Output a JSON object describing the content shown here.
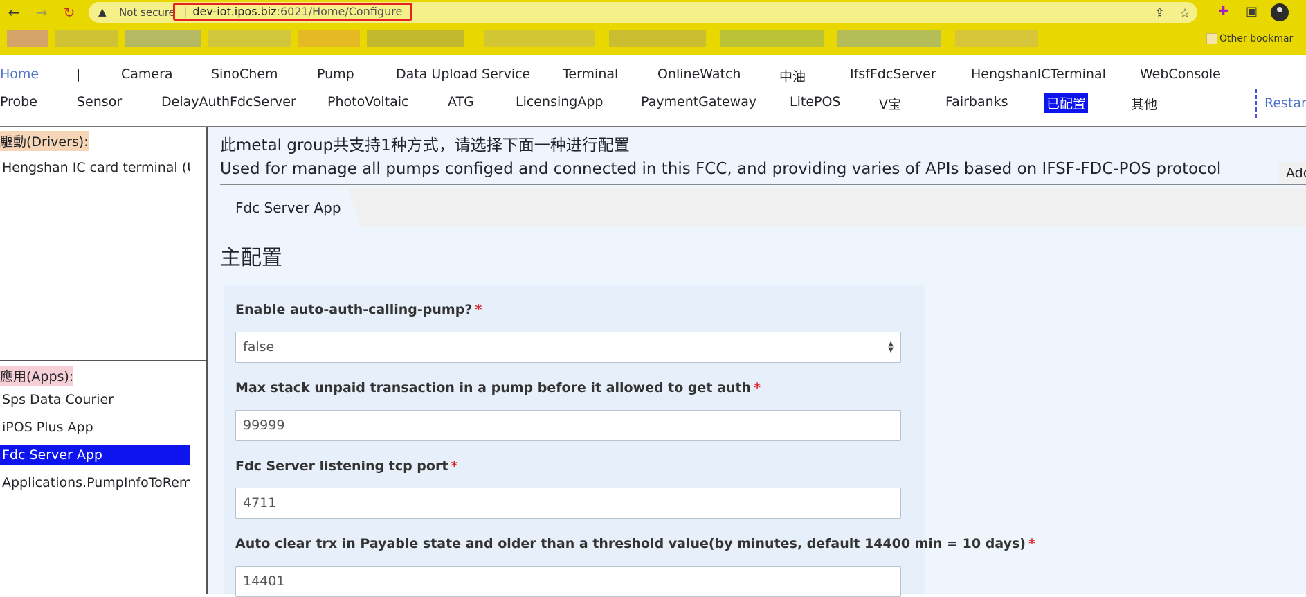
{
  "browser": {
    "security_label": "Not secure",
    "url_host": "dev-iot.ipos.biz",
    "url_path": ":6021/Home/Configure",
    "other_bookmarks": "Other bookmar"
  },
  "nav": {
    "row1": [
      "Home",
      "|",
      "Camera",
      "SinoChem",
      "Pump",
      "Data Upload Service",
      "Terminal",
      "OnlineWatch",
      "中油",
      "IfsfFdcServer",
      "HengshanICTerminal",
      "WebConsole"
    ],
    "row2": [
      "Probe",
      "Sensor",
      "DelayAuthFdcServer",
      "PhotoVoltaic",
      "ATG",
      "LicensingApp",
      "PaymentGateway",
      "LitePOS",
      "V宝",
      "Fairbanks",
      "已配置",
      "其他"
    ],
    "restart": "Restart"
  },
  "sidebar": {
    "drivers_title": "驅動(Drivers):",
    "drivers": [
      "Hengshan IC card terminal (UI"
    ],
    "apps_title": "應用(Apps):",
    "apps": [
      "Sps Data Courier",
      "iPOS Plus App",
      "Fdc Server App",
      "Applications.PumpInfoToRemo"
    ]
  },
  "main": {
    "group_title": "此metal group共支持1种方式，请选择下面一种进行配置",
    "group_desc": "Used for manage all pumps configed and connected in this FCC, and providing varies of APIs based on IFSF-FDC-POS protocol",
    "add_label": "Add",
    "tab_label": "Fdc Server App",
    "section_title": "主配置",
    "fields": [
      {
        "label": "Enable auto-auth-calling-pump?",
        "required": "*",
        "value": "false"
      },
      {
        "label": "Max stack unpaid transaction in a pump before it allowed to get auth",
        "required": "*",
        "value": "99999"
      },
      {
        "label": "Fdc Server listening tcp port",
        "required": "*",
        "value": "4711"
      },
      {
        "label": "Auto clear trx in Payable state and older than a threshold value(by minutes, default 14400 min = 10 days)",
        "required": "*",
        "value": "14401"
      }
    ]
  },
  "colors": {
    "chrome": "#e8d800",
    "active_item": "#0d14ee",
    "link": "#4d73c9",
    "url_highlight": "#e8231f",
    "content_bg": "#eef5fd"
  }
}
